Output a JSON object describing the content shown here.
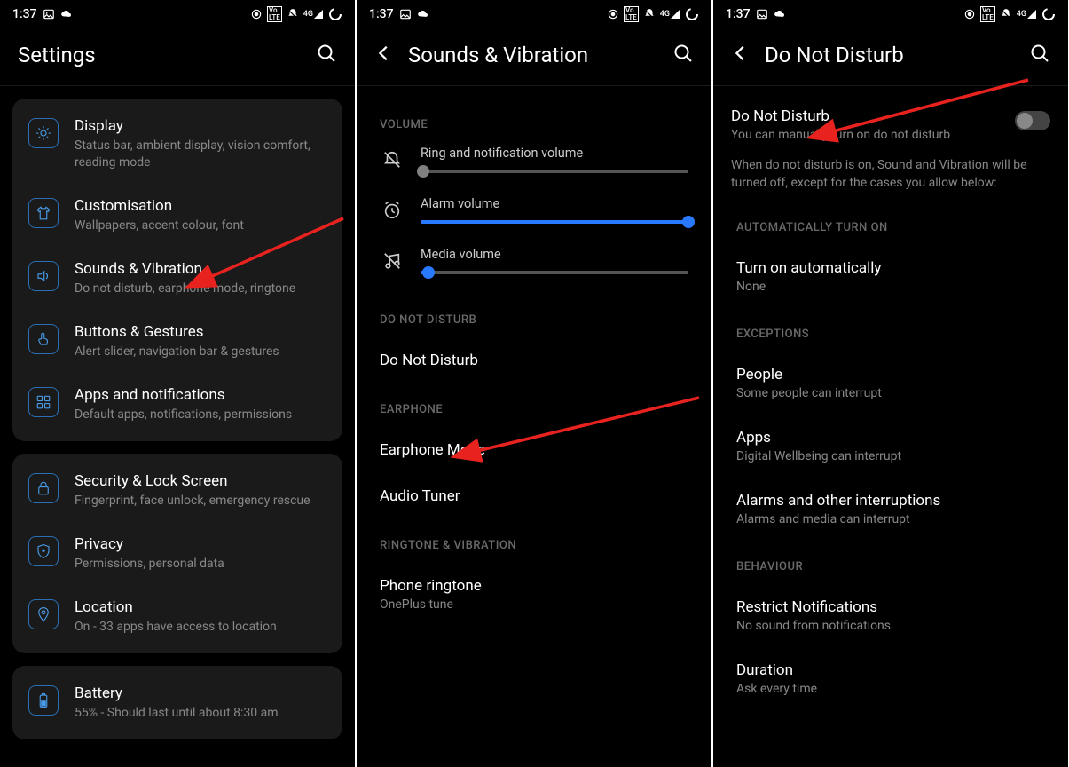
{
  "status": {
    "time": "1:37"
  },
  "screen1": {
    "title": "Settings",
    "cards": [
      {
        "items": [
          {
            "icon": "brightness",
            "title": "Display",
            "sub": "Status bar, ambient display, vision comfort, reading mode"
          },
          {
            "icon": "shirt",
            "title": "Customisation",
            "sub": "Wallpapers, accent colour, font"
          },
          {
            "icon": "volume",
            "title": "Sounds & Vibration",
            "sub": "Do not disturb, earphone mode, ringtone"
          },
          {
            "icon": "gestures",
            "title": "Buttons & Gestures",
            "sub": "Alert slider, navigation bar & gestures"
          },
          {
            "icon": "apps",
            "title": "Apps and notifications",
            "sub": "Default apps, notifications, permissions"
          }
        ]
      },
      {
        "items": [
          {
            "icon": "lock",
            "title": "Security & Lock Screen",
            "sub": "Fingerprint, face unlock, emergency rescue"
          },
          {
            "icon": "shield",
            "title": "Privacy",
            "sub": "Permissions, personal data"
          },
          {
            "icon": "pin",
            "title": "Location",
            "sub": "On - 33 apps have access to location"
          }
        ]
      },
      {
        "items": [
          {
            "icon": "battery",
            "title": "Battery",
            "sub": "55% - Should last until about 8:30 am"
          }
        ]
      }
    ]
  },
  "screen2": {
    "title": "Sounds & Vibration",
    "vol_header": "VOLUME",
    "sliders": [
      {
        "icon": "bell-off",
        "label": "Ring and notification volume",
        "value": 1,
        "thumb": "gray"
      },
      {
        "icon": "alarm",
        "label": "Alarm volume",
        "value": 100,
        "thumb": "blue"
      },
      {
        "icon": "music-off",
        "label": "Media volume",
        "value": 3,
        "thumb": "blue"
      }
    ],
    "dnd_header": "DO NOT DISTURB",
    "dnd_item": "Do Not Disturb",
    "ear_header": "EARPHONE",
    "ear_item": "Earphone Mode",
    "audio_item": "Audio Tuner",
    "ring_header": "RINGTONE & VIBRATION",
    "ring_item": "Phone ringtone",
    "ring_sub": "OnePlus tune"
  },
  "screen3": {
    "title": "Do Not Disturb",
    "main_title": "Do Not Disturb",
    "main_sub": "You can manually turn on do not disturb",
    "desc": "When do not disturb is on, Sound and Vibration will be turned off, except for the cases you allow below:",
    "auto_header": "AUTOMATICALLY TURN ON",
    "auto_title": "Turn on automatically",
    "auto_sub": "None",
    "exc_header": "EXCEPTIONS",
    "people_title": "People",
    "people_sub": "Some people can interrupt",
    "apps_title": "Apps",
    "apps_sub": "Digital Wellbeing can interrupt",
    "alarms_title": "Alarms and other interruptions",
    "alarms_sub": "Alarms and media can interrupt",
    "beh_header": "BEHAVIOUR",
    "restrict_title": "Restrict Notifications",
    "restrict_sub": "No sound from notifications",
    "dur_title": "Duration",
    "dur_sub": "Ask every time"
  }
}
